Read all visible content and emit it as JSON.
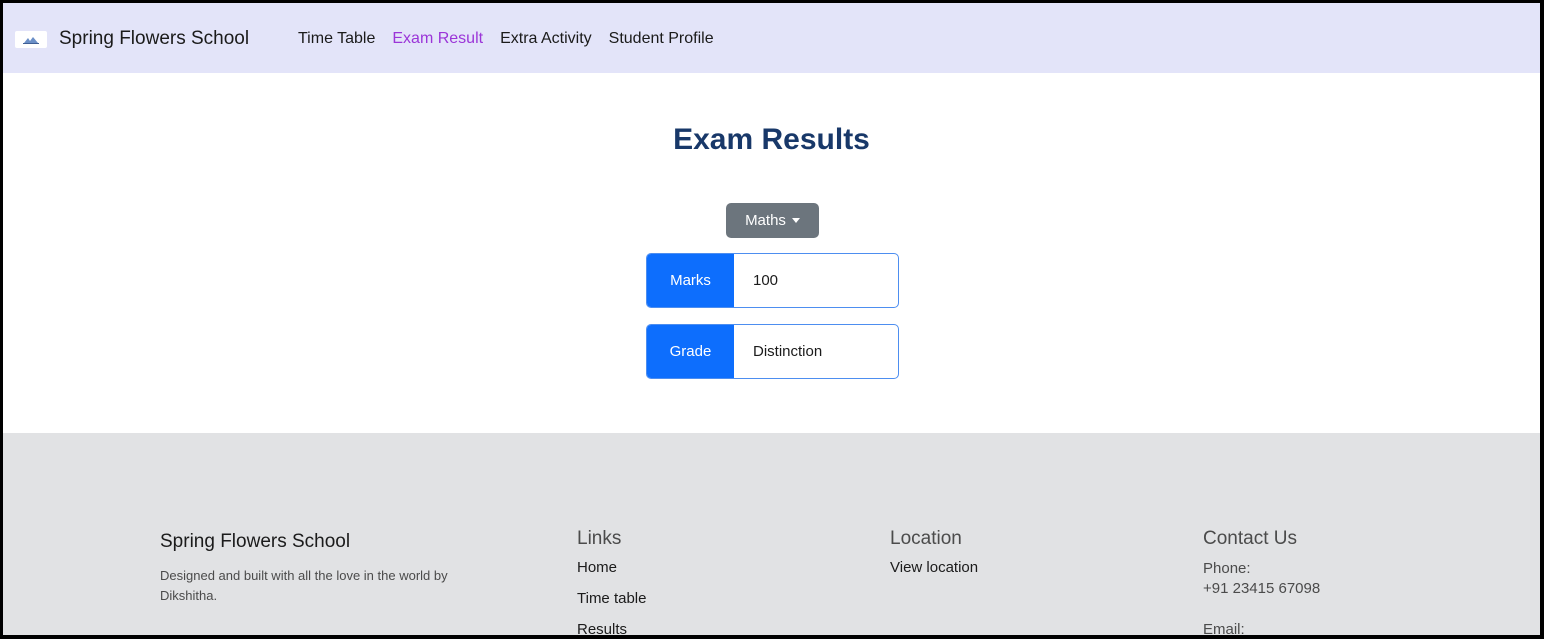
{
  "navbar": {
    "brand": "Spring Flowers School",
    "links": [
      {
        "label": "Time Table"
      },
      {
        "label": "Exam Result",
        "active": true
      },
      {
        "label": "Extra Activity"
      },
      {
        "label": "Student Profile"
      }
    ]
  },
  "main": {
    "title": "Exam Results",
    "subject_dropdown": {
      "selected": "Maths"
    },
    "marks": {
      "label": "Marks",
      "value": "100"
    },
    "grade": {
      "label": "Grade",
      "value": "Distinction"
    }
  },
  "footer": {
    "brand": "Spring Flowers School",
    "description": "Designed and built with all the love in the world by Dikshitha.",
    "links": {
      "heading": "Links",
      "items": [
        "Home",
        "Time table",
        "Results"
      ]
    },
    "location": {
      "heading": "Location",
      "items": [
        "View location"
      ]
    },
    "contact": {
      "heading": "Contact Us",
      "phone_label": "Phone:",
      "phone_value": "+91 23415 67098",
      "email_label": "Email:"
    }
  },
  "colors": {
    "navbar_bg": "#e3e4f9",
    "active_link": "#9b35d8",
    "title": "#183869",
    "primary": "#0d6efd",
    "secondary": "#6c757d",
    "footer_bg": "#e1e2e4"
  }
}
